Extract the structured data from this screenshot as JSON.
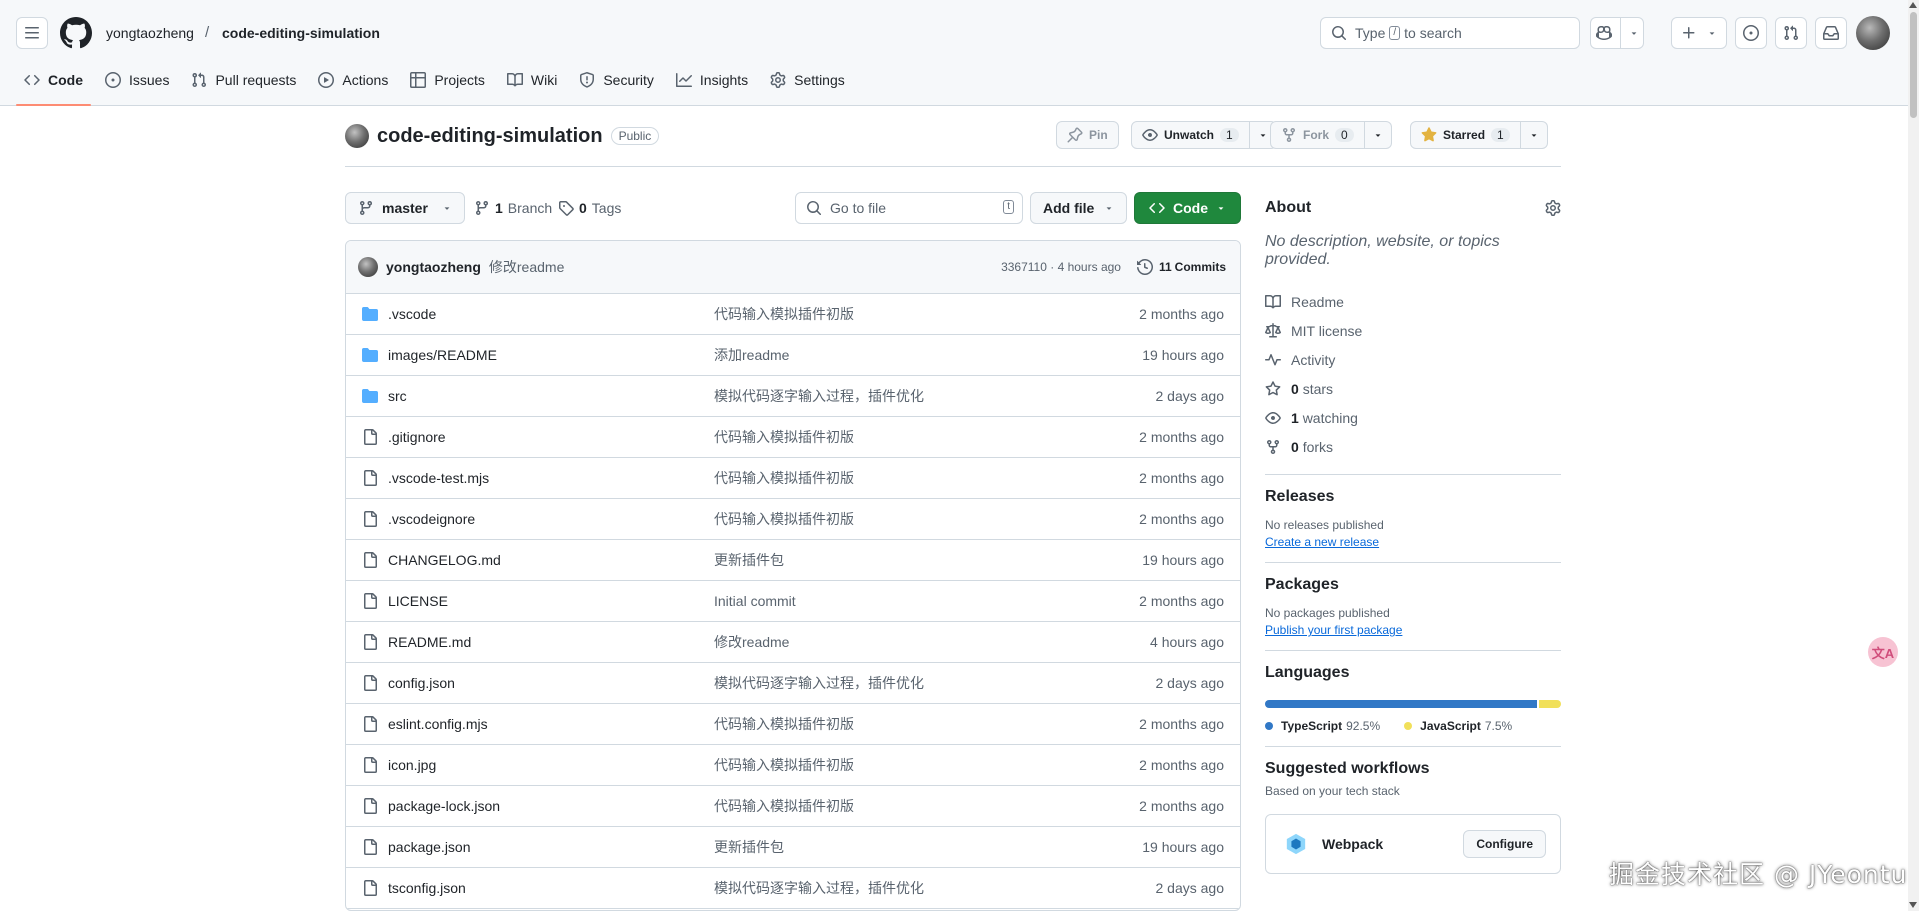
{
  "header": {
    "owner": "yongtaozheng",
    "separator": "/",
    "repo": "code-editing-simulation",
    "search": {
      "prefix": "Type",
      "key": "/",
      "suffix": "to search"
    }
  },
  "nav": [
    {
      "label": "Code",
      "icon": "code-icon",
      "selected": true
    },
    {
      "label": "Issues",
      "icon": "issue-icon"
    },
    {
      "label": "Pull requests",
      "icon": "pull-request-icon"
    },
    {
      "label": "Actions",
      "icon": "play-icon"
    },
    {
      "label": "Projects",
      "icon": "table-icon"
    },
    {
      "label": "Wiki",
      "icon": "book-icon"
    },
    {
      "label": "Security",
      "icon": "shield-icon"
    },
    {
      "label": "Insights",
      "icon": "graph-icon"
    },
    {
      "label": "Settings",
      "icon": "gear-icon"
    }
  ],
  "repo_header": {
    "name": "code-editing-simulation",
    "visibility": "Public",
    "pin_label": "Pin",
    "watch_label": "Unwatch",
    "watch_count": "1",
    "fork_label": "Fork",
    "fork_count": "0",
    "star_label": "Starred",
    "star_count": "1"
  },
  "toolbar": {
    "branch": "master",
    "branch_count": "1",
    "branch_label": "Branch",
    "tag_count": "0",
    "tag_label": "Tags",
    "goto_placeholder": "Go to file",
    "goto_key": "t",
    "add_file": "Add file",
    "code": "Code"
  },
  "commit": {
    "author": "yongtaozheng",
    "message": "修改readme",
    "sha": "3367110",
    "sep": "·",
    "time": "4 hours ago",
    "commits_count": "11",
    "commits_label": "Commits"
  },
  "files": [
    {
      "type": "dir",
      "name": ".vscode",
      "message": "代码输入模拟插件初版",
      "age": "2 months ago"
    },
    {
      "type": "dir",
      "name": "images/README",
      "message": "添加readme",
      "age": "19 hours ago"
    },
    {
      "type": "dir",
      "name": "src",
      "message": "模拟代码逐字输入过程，插件优化",
      "age": "2 days ago"
    },
    {
      "type": "file",
      "name": ".gitignore",
      "message": "代码输入模拟插件初版",
      "age": "2 months ago"
    },
    {
      "type": "file",
      "name": ".vscode-test.mjs",
      "message": "代码输入模拟插件初版",
      "age": "2 months ago"
    },
    {
      "type": "file",
      "name": ".vscodeignore",
      "message": "代码输入模拟插件初版",
      "age": "2 months ago"
    },
    {
      "type": "file",
      "name": "CHANGELOG.md",
      "message": "更新插件包",
      "age": "19 hours ago"
    },
    {
      "type": "file",
      "name": "LICENSE",
      "message": "Initial commit",
      "age": "2 months ago"
    },
    {
      "type": "file",
      "name": "README.md",
      "message": "修改readme",
      "age": "4 hours ago"
    },
    {
      "type": "file",
      "name": "config.json",
      "message": "模拟代码逐字输入过程，插件优化",
      "age": "2 days ago"
    },
    {
      "type": "file",
      "name": "eslint.config.mjs",
      "message": "代码输入模拟插件初版",
      "age": "2 months ago"
    },
    {
      "type": "file",
      "name": "icon.jpg",
      "message": "代码输入模拟插件初版",
      "age": "2 months ago"
    },
    {
      "type": "file",
      "name": "package-lock.json",
      "message": "代码输入模拟插件初版",
      "age": "2 months ago"
    },
    {
      "type": "file",
      "name": "package.json",
      "message": "更新插件包",
      "age": "19 hours ago"
    },
    {
      "type": "file",
      "name": "tsconfig.json",
      "message": "模拟代码逐字输入过程，插件优化",
      "age": "2 days ago"
    }
  ],
  "sidebar": {
    "about_title": "About",
    "about_desc": "No description, website, or topics provided.",
    "about_items": [
      {
        "icon": "book-icon",
        "bold": "",
        "text": "Readme"
      },
      {
        "icon": "scale-icon",
        "bold": "",
        "text": "MIT license"
      },
      {
        "icon": "pulse-icon",
        "bold": "",
        "text": "Activity"
      },
      {
        "icon": "star-icon",
        "bold": "0",
        "text": "stars"
      },
      {
        "icon": "eye-icon",
        "bold": "1",
        "text": "watching"
      },
      {
        "icon": "fork-icon",
        "bold": "0",
        "text": "forks"
      }
    ],
    "releases_title": "Releases",
    "releases_text": "No releases published",
    "releases_link": "Create a new release",
    "packages_title": "Packages",
    "packages_text": "No packages published",
    "packages_link": "Publish your first package",
    "languages_title": "Languages",
    "languages": [
      {
        "name": "TypeScript",
        "percent": "92.5%",
        "value": 92.5,
        "color": "#3178c6"
      },
      {
        "name": "JavaScript",
        "percent": "7.5%",
        "value": 7.5,
        "color": "#f1e05a"
      }
    ],
    "workflows_title": "Suggested workflows",
    "workflows_sub": "Based on your tech stack",
    "workflow_name": "Webpack",
    "workflow_button": "Configure"
  },
  "overlay": {
    "float_icon": "translate-icon",
    "float_glyph": "文A",
    "watermark": "掘金技术社区 @ JYeontu"
  },
  "colors": {
    "accent_green": "#1f883d",
    "nav_underline": "#fd8c73",
    "link": "#0969da",
    "folder": "#54aeff"
  }
}
